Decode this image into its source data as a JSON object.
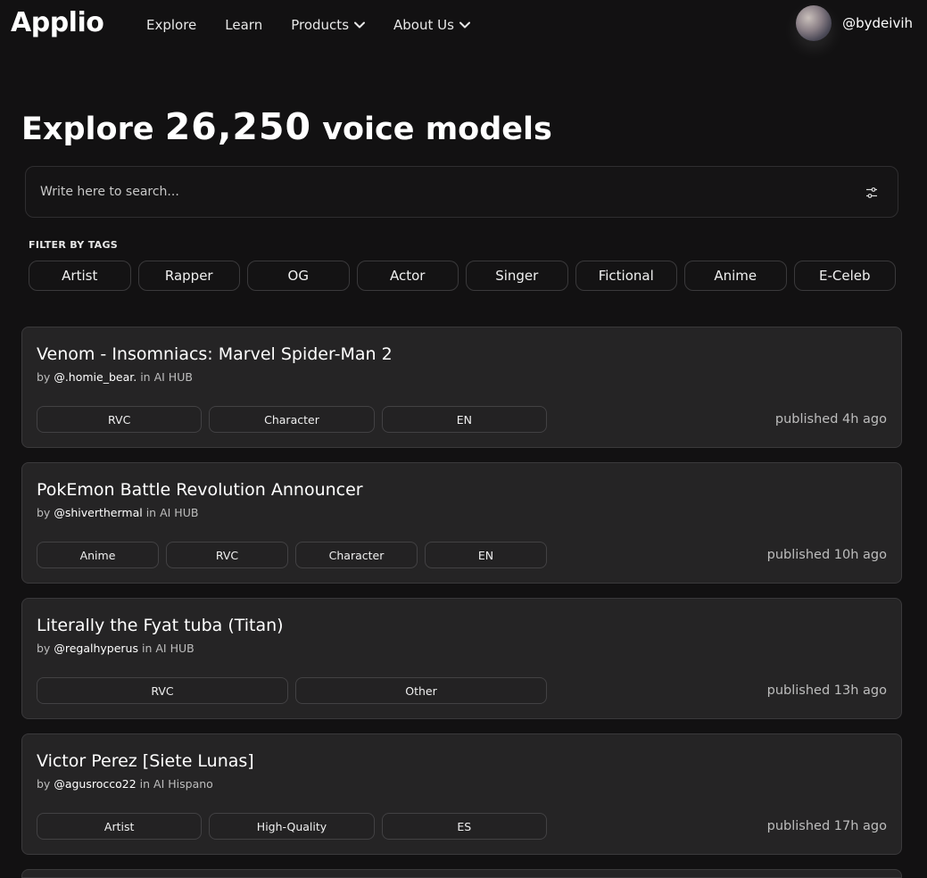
{
  "header": {
    "logo": "Applio",
    "nav": [
      {
        "label": "Explore",
        "has_dropdown": false
      },
      {
        "label": "Learn",
        "has_dropdown": false
      },
      {
        "label": "Products",
        "has_dropdown": true
      },
      {
        "label": "About Us",
        "has_dropdown": true
      }
    ],
    "username": "@bydeivih"
  },
  "headline": {
    "prefix": "Explore",
    "count": "26,250",
    "suffix": "voice models"
  },
  "search": {
    "placeholder": "Write here to search...",
    "value": "",
    "filter_icon": "sliders-icon"
  },
  "tags": {
    "label": "FILTER BY TAGS",
    "items": [
      "Artist",
      "Rapper",
      "OG",
      "Actor",
      "Singer",
      "Fictional",
      "Anime",
      "E-Celeb"
    ]
  },
  "models": [
    {
      "title": "Venom - Insomniacs: Marvel Spider-Man 2",
      "by": "by",
      "author": "@.homie_bear.",
      "in": "in",
      "hub": "AI HUB",
      "tags": [
        "RVC",
        "Character",
        "EN"
      ],
      "published": "published 4h ago"
    },
    {
      "title": "PokEmon Battle Revolution Announcer",
      "by": "by",
      "author": "@shiverthermal",
      "in": "in",
      "hub": "AI HUB",
      "tags": [
        "Anime",
        "RVC",
        "Character",
        "EN"
      ],
      "published": "published 10h ago"
    },
    {
      "title": "Literally the Fyat tuba (Titan)",
      "by": "by",
      "author": "@regalhyperus",
      "in": "in",
      "hub": "AI HUB",
      "tags": [
        "RVC",
        "Other"
      ],
      "published": "published 13h ago"
    },
    {
      "title": "Victor Perez [Siete Lunas]",
      "by": "by",
      "author": "@agusrocco22",
      "in": "in",
      "hub": "AI Hispano",
      "tags": [
        "Artist",
        "High-Quality",
        "ES"
      ],
      "published": "published 17h ago"
    }
  ]
}
